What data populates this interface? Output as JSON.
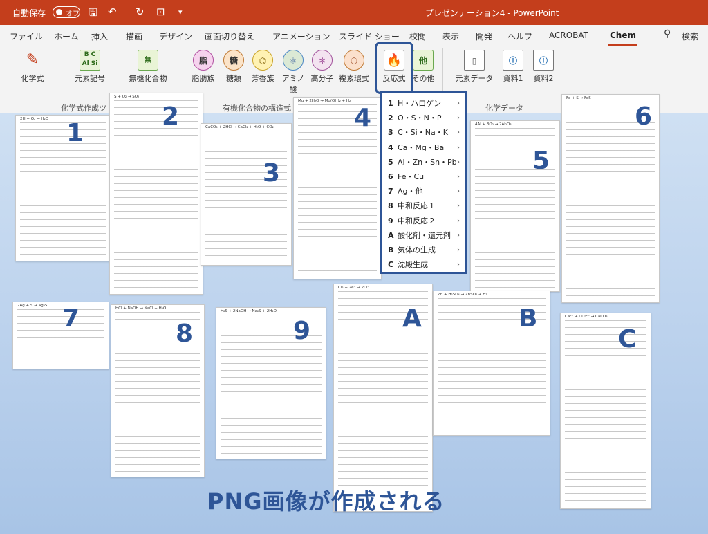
{
  "titlebar": {
    "autosave_label": "自動保存",
    "autosave_state": "オフ",
    "document_title": "プレゼンテーション4 - PowerPoint"
  },
  "menu": {
    "tabs": [
      "ファイル",
      "ホーム",
      "挿入",
      "描画",
      "デザイン",
      "画面切り替え",
      "アニメーション",
      "スライド ショー",
      "校閲",
      "表示",
      "開発",
      "ヘルプ",
      "ACROBAT",
      "Chem"
    ],
    "active": "Chem",
    "search": "検索"
  },
  "ribbon": {
    "buttons": [
      {
        "label": "化学式",
        "icon": "pen-icon"
      },
      {
        "label": "元素記号",
        "icon": "element-grid-icon"
      },
      {
        "label": "無機化合物",
        "icon": "inorganic-icon"
      },
      {
        "label": "脂肪族",
        "icon": "fat-icon",
        "glyph": "脂"
      },
      {
        "label": "糖類",
        "icon": "sugar-icon",
        "glyph": "糖"
      },
      {
        "label": "芳香族",
        "icon": "aromatic-icon"
      },
      {
        "label": "アミノ酸",
        "icon": "amino-icon"
      },
      {
        "label": "高分子",
        "icon": "polymer-icon"
      },
      {
        "label": "複素環式",
        "icon": "heterocycle-icon"
      },
      {
        "label": "反応式",
        "icon": "flame-icon"
      },
      {
        "label": "その他",
        "icon": "other-icon",
        "glyph": "他"
      },
      {
        "label": "元素データ",
        "icon": "document-icon"
      },
      {
        "label": "資料1",
        "icon": "info-doc-icon"
      },
      {
        "label": "資料2",
        "icon": "info-doc-icon"
      }
    ],
    "groups": [
      "化学式作成ツ",
      "有機化合物の構造式",
      "化学データ"
    ]
  },
  "dropdown": {
    "items": [
      {
        "key": "1",
        "label": "H・ハロゲン"
      },
      {
        "key": "2",
        "label": "O・S・N・P"
      },
      {
        "key": "3",
        "label": "C・Si・Na・K"
      },
      {
        "key": "4",
        "label": "Ca・Mg・Ba"
      },
      {
        "key": "5",
        "label": "Al・Zn・Sn・Pb"
      },
      {
        "key": "6",
        "label": "Fe・Cu"
      },
      {
        "key": "7",
        "label": "Ag・他"
      },
      {
        "key": "8",
        "label": "中和反応１"
      },
      {
        "key": "9",
        "label": "中和反応２"
      },
      {
        "key": "A",
        "label": "酸化剤・還元剤"
      },
      {
        "key": "B",
        "label": "気体の生成"
      },
      {
        "key": "C",
        "label": "沈殿生成"
      }
    ]
  },
  "sheets": {
    "s1": {
      "num": "1",
      "eq": "2H + O₂ → H₂O"
    },
    "s2": {
      "num": "2",
      "eq": "S + O₂ → SO₂"
    },
    "s3": {
      "num": "3",
      "eq": "CaCO₃ + 2HCl → CaCl₂ + H₂O + CO₂"
    },
    "s4": {
      "num": "4",
      "eq": "Mg + 2H₂O → Mg(OH)₂ + H₂"
    },
    "s5": {
      "num": "5",
      "eq": "4Al + 3O₂ → 2Al₂O₃"
    },
    "s6": {
      "num": "6",
      "eq": "Fe + S → FeS"
    },
    "s7": {
      "num": "7",
      "eq": "2Ag + S → Ag₂S"
    },
    "s8": {
      "num": "8",
      "eq": "HCl + NaOH → NaCl + H₂O"
    },
    "s9": {
      "num": "9",
      "eq": "H₂S + 2NaOH → Na₂S + 2H₂O"
    },
    "sA": {
      "num": "A",
      "eq": "Cl₂ + 2e⁻ → 2Cl⁻"
    },
    "sB": {
      "num": "B",
      "eq": "Zn + H₂SO₄ → ZnSO₄ + H₂"
    },
    "sC": {
      "num": "C",
      "eq": "Ca²⁺ + CO₃²⁻ → CaCO₃"
    }
  },
  "caption": "PNG画像が作成される"
}
